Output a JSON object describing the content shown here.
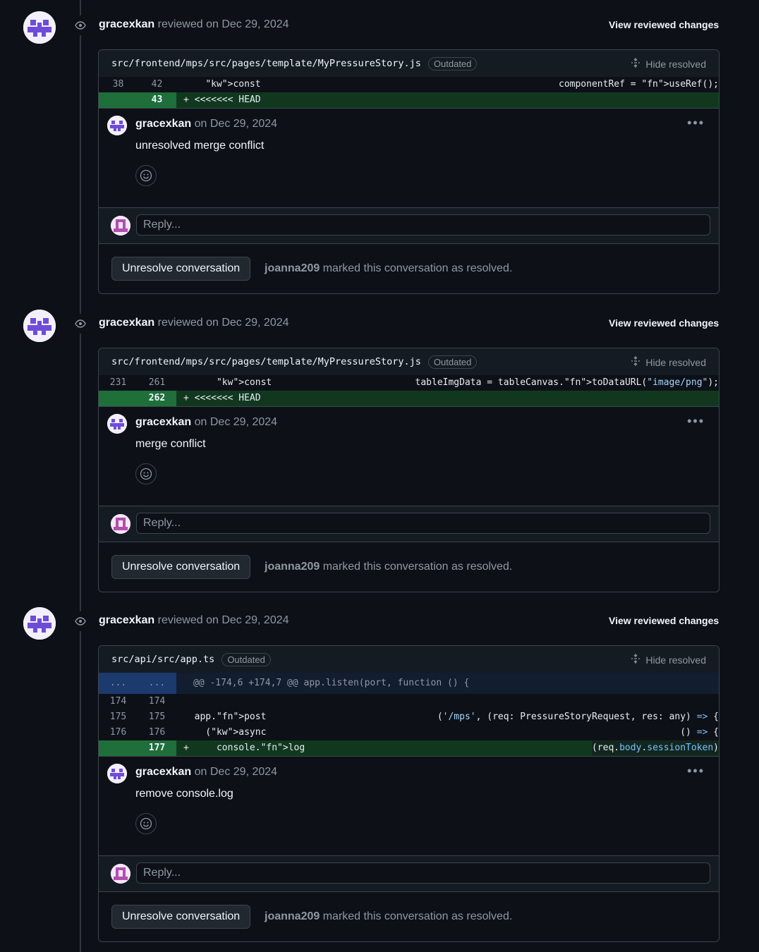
{
  "reviews": [
    {
      "reviewer": "gracexkan",
      "reviewed_text": "reviewed on Dec 29, 2024",
      "view_changes": "View reviewed changes",
      "file_path": "src/frontend/mps/src/pages/template/MyPressureStory.js",
      "outdated": "Outdated",
      "hide_resolved": "Hide resolved",
      "lines": [
        {
          "old": "38",
          "new": "42",
          "type": "context",
          "text": "    const componentRef = useRef();"
        },
        {
          "old": "",
          "new": "43",
          "type": "added",
          "text": "+ <<<<<<< HEAD"
        }
      ],
      "comment": {
        "author": "gracexkan",
        "date": "on Dec 29, 2024",
        "body": "unresolved merge conflict"
      },
      "reply_placeholder": "Reply...",
      "unresolve_label": "Unresolve conversation",
      "resolved_by": "joanna209",
      "resolved_text": "marked this conversation as resolved."
    },
    {
      "reviewer": "gracexkan",
      "reviewed_text": "reviewed on Dec 29, 2024",
      "view_changes": "View reviewed changes",
      "file_path": "src/frontend/mps/src/pages/template/MyPressureStory.js",
      "outdated": "Outdated",
      "hide_resolved": "Hide resolved",
      "lines": [
        {
          "old": "231",
          "new": "261",
          "type": "context",
          "text": "      const tableImgData = tableCanvas.toDataURL(\"image/png\");"
        },
        {
          "old": "",
          "new": "262",
          "type": "added",
          "text": "+ <<<<<<< HEAD"
        }
      ],
      "comment": {
        "author": "gracexkan",
        "date": "on Dec 29, 2024",
        "body": "merge conflict"
      },
      "reply_placeholder": "Reply...",
      "unresolve_label": "Unresolve conversation",
      "resolved_by": "joanna209",
      "resolved_text": "marked this conversation as resolved."
    },
    {
      "reviewer": "gracexkan",
      "reviewed_text": "reviewed on Dec 29, 2024",
      "view_changes": "View reviewed changes",
      "file_path": "src/api/src/app.ts",
      "outdated": "Outdated",
      "hide_resolved": "Hide resolved",
      "lines": [
        {
          "old": "...",
          "new": "...",
          "type": "hunk",
          "text": "@@ -174,6 +174,7 @@ app.listen(port, function () {"
        },
        {
          "old": "174",
          "new": "174",
          "type": "context",
          "text": ""
        },
        {
          "old": "175",
          "new": "175",
          "type": "context",
          "text": "  app.post('/mps', (req: PressureStoryRequest, res: any) => {"
        },
        {
          "old": "176",
          "new": "176",
          "type": "context",
          "text": "    (async () => {"
        },
        {
          "old": "",
          "new": "177",
          "type": "added",
          "text": "+     console.log(req.body.sessionToken)"
        }
      ],
      "comment": {
        "author": "gracexkan",
        "date": "on Dec 29, 2024",
        "body": "remove console.log"
      },
      "reply_placeholder": "Reply...",
      "unresolve_label": "Unresolve conversation",
      "resolved_by": "joanna209",
      "resolved_text": "marked this conversation as resolved."
    }
  ],
  "icons": {
    "review": "eye-icon",
    "hide_resolved": "fold-icon",
    "reaction": "smiley-icon",
    "menu": "kebab-horizontal-icon"
  },
  "colors": {
    "background": "#0d1117",
    "added_line": "#11381f",
    "hunk_header": "#121d2f",
    "keyword": "#ff7b72",
    "function": "#d2a8ff"
  }
}
